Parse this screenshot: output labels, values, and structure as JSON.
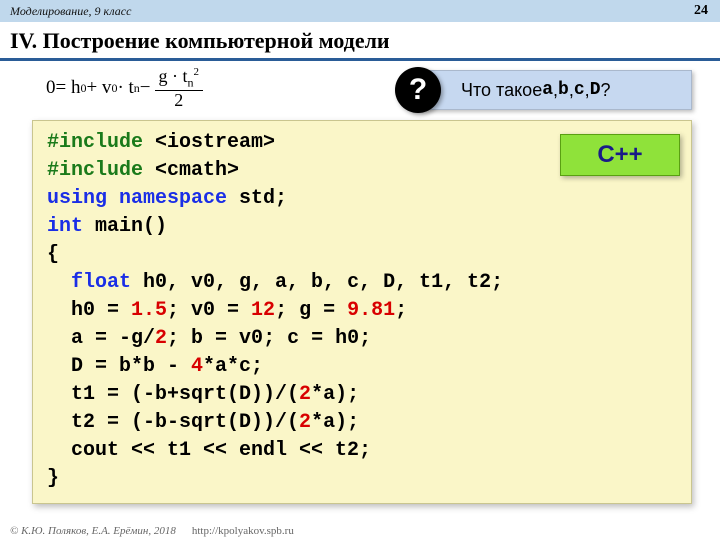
{
  "header": {
    "course": "Моделирование, 9 класс",
    "page": "24"
  },
  "title": "IV. Построение компьютерной модели",
  "formula": {
    "lhs": "0",
    "rhs_pre": " = h",
    "sub0": "0",
    "plus1": " + v",
    "subv": "0",
    "dot": " · t",
    "subtn": "n",
    "minus": " − ",
    "frac_num_g": "g · t",
    "frac_num_sub": "n",
    "frac_num_sup": "2",
    "frac_den": "2"
  },
  "callout": {
    "q": "?",
    "prefix": "Что такое ",
    "a": "a",
    "b": "b",
    "c": "c",
    "d": "D",
    "sep": ", ",
    "qmark": "?"
  },
  "badge": "C++",
  "code": {
    "l1a": "#include ",
    "l1b": "<iostream>",
    "l2a": "#include ",
    "l2b": "<cmath>",
    "l3a": "using ",
    "l3b": "namespace ",
    "l3c": "std;",
    "l4a": "int ",
    "l4b": "main()",
    "l5": "{",
    "l6a": "  ",
    "l6b": "float ",
    "l6c": "h0, v0, g, a, b, c, D, t1, t2;",
    "l7a": "  h0 = ",
    "l7b": "1.5",
    "l7c": "; v0 = ",
    "l7d": "12",
    "l7e": "; g = ",
    "l7f": "9.81",
    "l7g": ";",
    "l8a": "  a = -g/",
    "l8b": "2",
    "l8c": "; b = v0; c = h0;",
    "l9a": "  D = b*b - ",
    "l9b": "4",
    "l9c": "*a*c;",
    "l10a": "  t1 = (-b+sqrt(D))/(",
    "l10b": "2",
    "l10c": "*a);",
    "l11a": "  t2 = (-b-sqrt(D))/(",
    "l11b": "2",
    "l11c": "*a);",
    "l12": "  cout << t1 << endl << t2;",
    "l13": "}"
  },
  "footer": {
    "copy": "© К.Ю. Поляков, Е.А. Ерёмин, 2018",
    "url": "http://kpolyakov.spb.ru"
  }
}
